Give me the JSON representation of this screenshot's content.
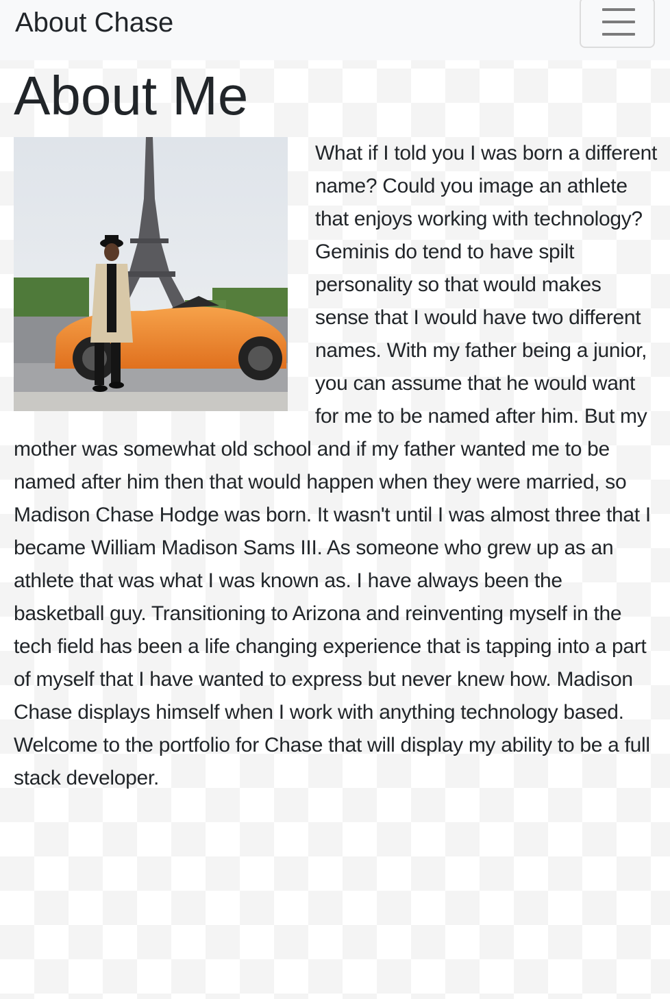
{
  "navbar": {
    "brand": "About Chase",
    "menu_icon": "hamburger-menu-icon"
  },
  "main": {
    "title": "About Me",
    "photo_icon": "profile-photo",
    "bio": "What if I told you I was born a different name? Could you image an athlete that enjoys working with technology? Geminis do tend to have spilt personality so that would makes sense that I would have two different names. With my father being a junior, you can assume that he would want for me to be named after him. But my mother was somewhat old school and if my father wanted me to be named after him then that would happen when they were married, so Madison Chase Hodge was born. It wasn't until I was almost three that I became William Madison Sams III. As someone who grew up as an athlete that was what I was known as. I have always been the basketball guy. Transitioning to Arizona and reinventing myself in the tech field has been a life changing experience that is tapping into a part of myself that I have wanted to express but never knew how. Madison Chase displays himself when I work with anything technology based. Welcome to the portfolio for Chase that will display my ability to be a full stack developer."
  },
  "colors": {
    "navbar_bg": "#f8f9fa",
    "text": "#212529",
    "car": "#f08a2e"
  }
}
